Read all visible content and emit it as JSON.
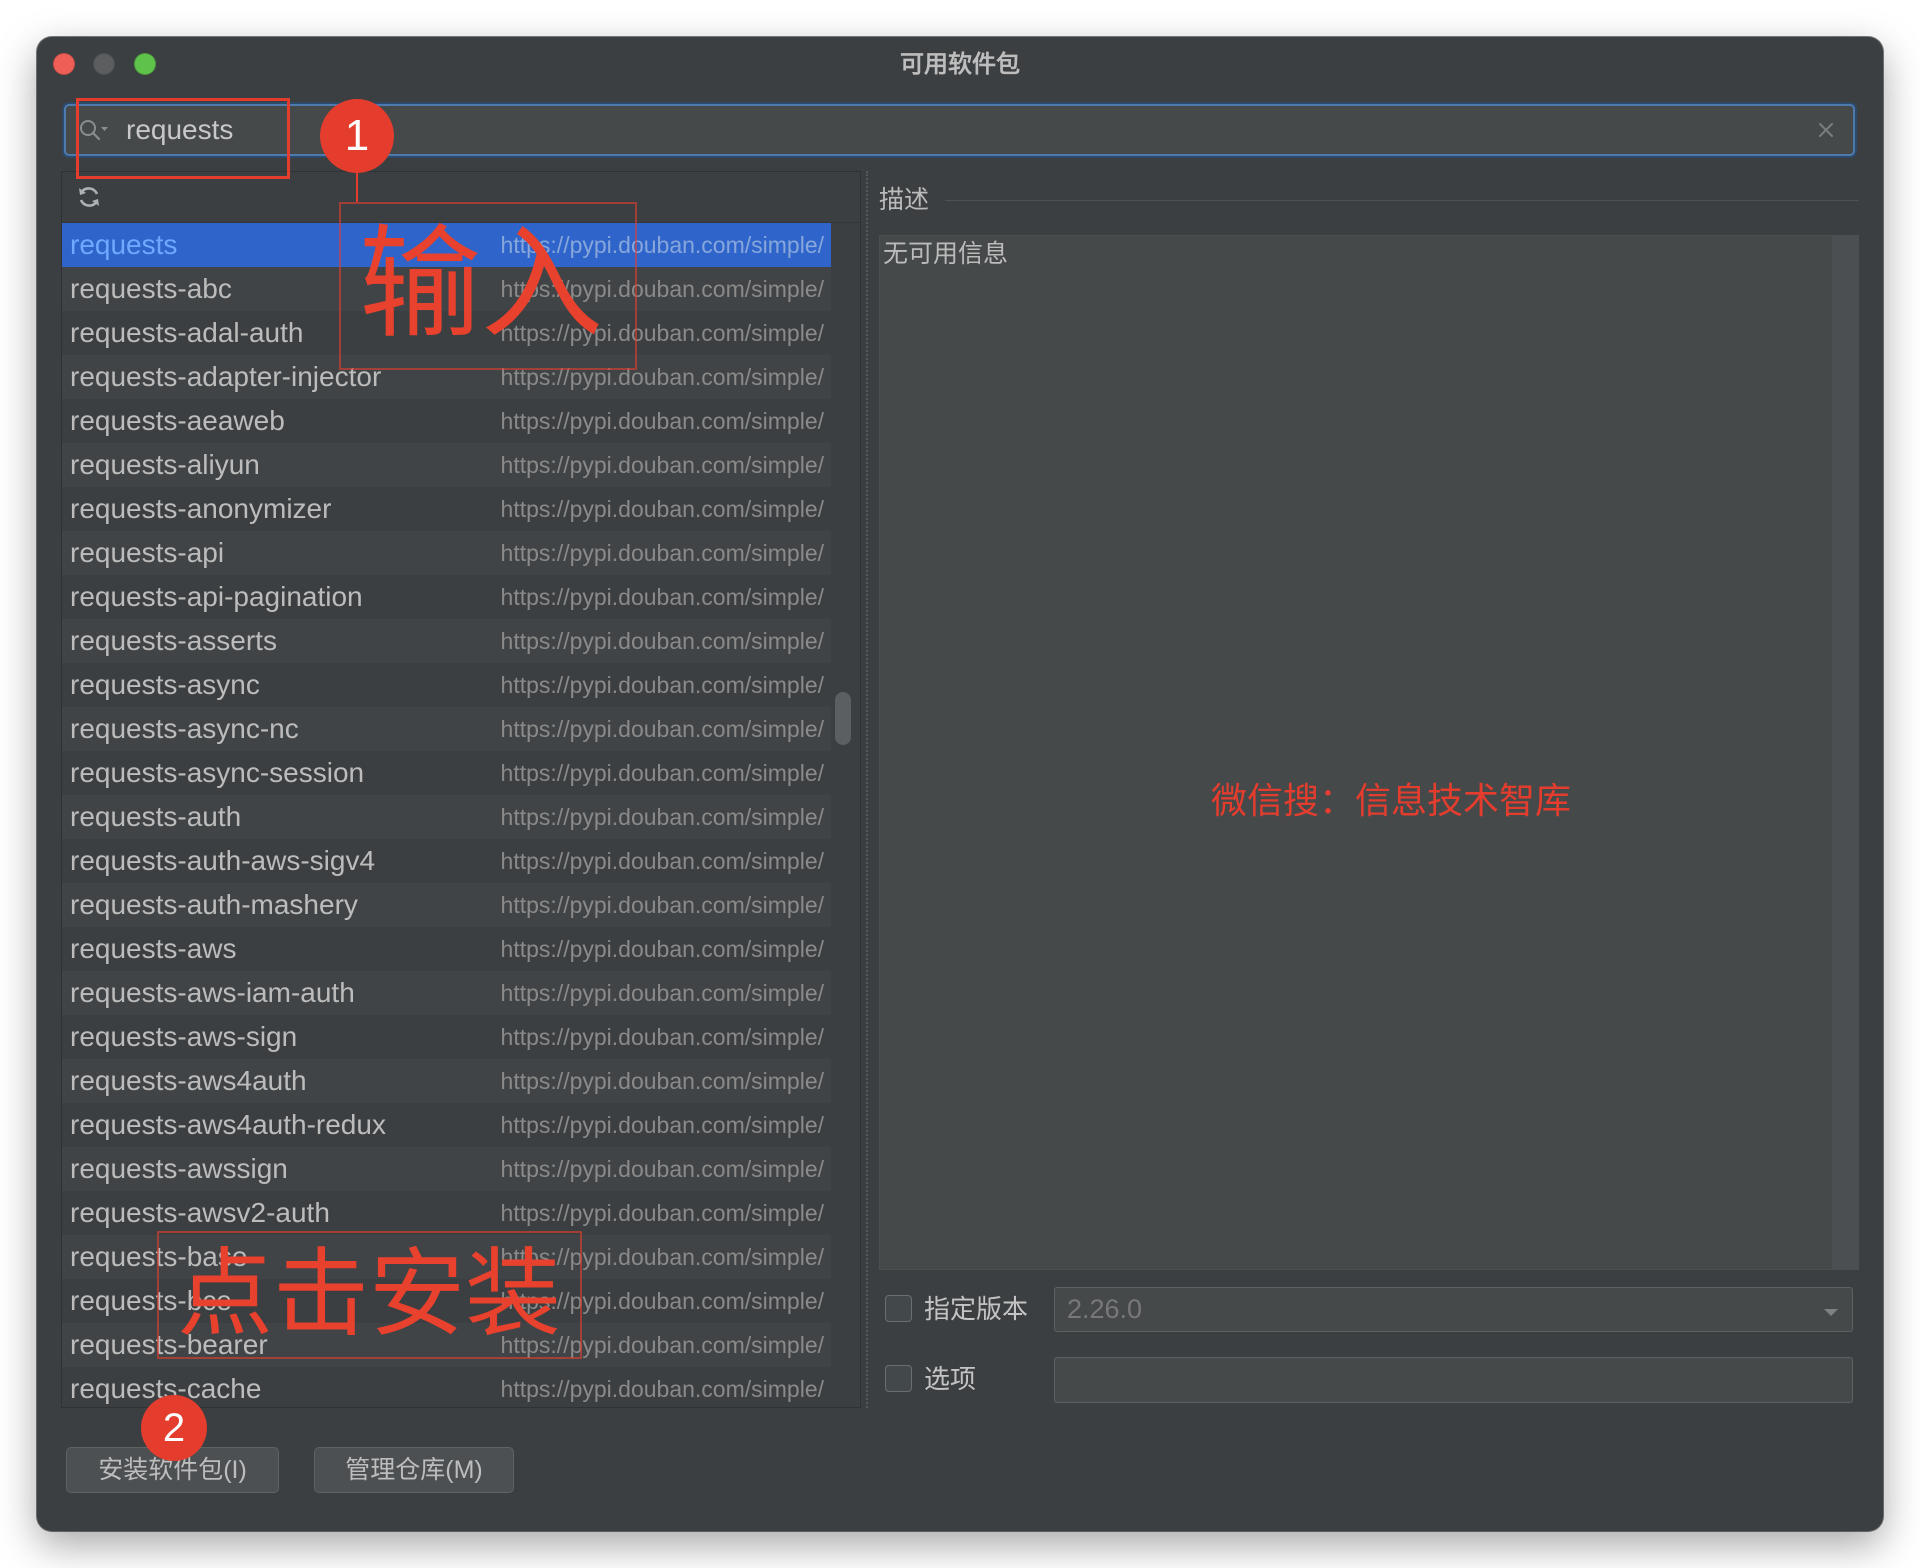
{
  "window": {
    "title": "可用软件包"
  },
  "theme": {
    "selection": "#2f65ca",
    "annotation": "#e43d2e",
    "traffic_close": "#ee5f57",
    "traffic_minimize": "#5c5e60",
    "traffic_zoom": "#5ec24b"
  },
  "icons": {
    "search": "search-icon",
    "clear": "close-icon",
    "refresh": "refresh-icon",
    "dropdown": "chevron-down-icon"
  },
  "search": {
    "value": "requests"
  },
  "packages": {
    "selected_index": 0,
    "items": [
      {
        "name": "requests",
        "repo": "https://pypi.douban.com/simple/"
      },
      {
        "name": "requests-abc",
        "repo": "https://pypi.douban.com/simple/"
      },
      {
        "name": "requests-adal-auth",
        "repo": "https://pypi.douban.com/simple/"
      },
      {
        "name": "requests-adapter-injector",
        "repo": "https://pypi.douban.com/simple/"
      },
      {
        "name": "requests-aeaweb",
        "repo": "https://pypi.douban.com/simple/"
      },
      {
        "name": "requests-aliyun",
        "repo": "https://pypi.douban.com/simple/"
      },
      {
        "name": "requests-anonymizer",
        "repo": "https://pypi.douban.com/simple/"
      },
      {
        "name": "requests-api",
        "repo": "https://pypi.douban.com/simple/"
      },
      {
        "name": "requests-api-pagination",
        "repo": "https://pypi.douban.com/simple/"
      },
      {
        "name": "requests-asserts",
        "repo": "https://pypi.douban.com/simple/"
      },
      {
        "name": "requests-async",
        "repo": "https://pypi.douban.com/simple/"
      },
      {
        "name": "requests-async-nc",
        "repo": "https://pypi.douban.com/simple/"
      },
      {
        "name": "requests-async-session",
        "repo": "https://pypi.douban.com/simple/"
      },
      {
        "name": "requests-auth",
        "repo": "https://pypi.douban.com/simple/"
      },
      {
        "name": "requests-auth-aws-sigv4",
        "repo": "https://pypi.douban.com/simple/"
      },
      {
        "name": "requests-auth-mashery",
        "repo": "https://pypi.douban.com/simple/"
      },
      {
        "name": "requests-aws",
        "repo": "https://pypi.douban.com/simple/"
      },
      {
        "name": "requests-aws-iam-auth",
        "repo": "https://pypi.douban.com/simple/"
      },
      {
        "name": "requests-aws-sign",
        "repo": "https://pypi.douban.com/simple/"
      },
      {
        "name": "requests-aws4auth",
        "repo": "https://pypi.douban.com/simple/"
      },
      {
        "name": "requests-aws4auth-redux",
        "repo": "https://pypi.douban.com/simple/"
      },
      {
        "name": "requests-awssign",
        "repo": "https://pypi.douban.com/simple/"
      },
      {
        "name": "requests-awsv2-auth",
        "repo": "https://pypi.douban.com/simple/"
      },
      {
        "name": "requests-base",
        "repo": "https://pypi.douban.com/simple/"
      },
      {
        "name": "requests-bce",
        "repo": "https://pypi.douban.com/simple/"
      },
      {
        "name": "requests-bearer",
        "repo": "https://pypi.douban.com/simple/"
      },
      {
        "name": "requests-cache",
        "repo": "https://pypi.douban.com/simple/"
      }
    ]
  },
  "description": {
    "label": "描述",
    "text": "无可用信息"
  },
  "version": {
    "label": "指定版本",
    "checked": false,
    "value": "2.26.0"
  },
  "options": {
    "label": "选项",
    "checked": false
  },
  "buttons": {
    "install": "安装软件包(I)",
    "manage_repos": "管理仓库(M)"
  },
  "annotations": {
    "step1_number": "1",
    "step1_label": "输入",
    "step2_number": "2",
    "step2_label": "点击安装",
    "watermark": "微信搜：信息技术智库"
  }
}
